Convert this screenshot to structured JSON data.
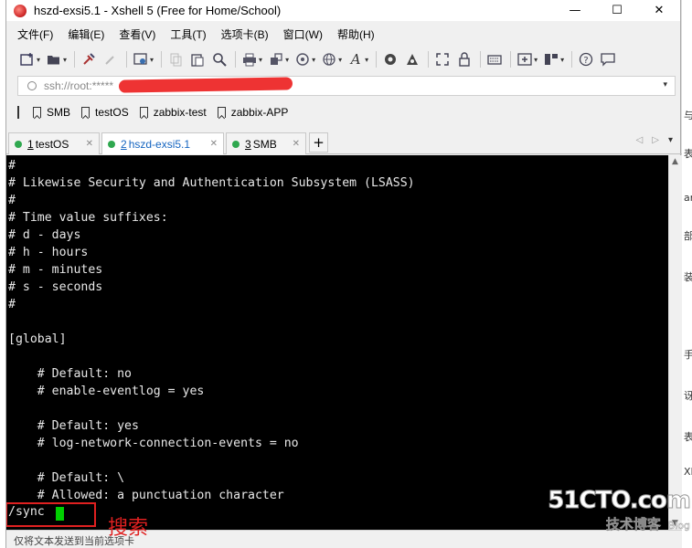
{
  "window": {
    "title": "hszd-exsi5.1 - Xshell 5 (Free for Home/School)",
    "controls": {
      "minimize": "—",
      "maximize": "☐",
      "close": "✕"
    }
  },
  "menu": [
    "文件(F)",
    "编辑(E)",
    "查看(V)",
    "工具(T)",
    "选项卡(B)",
    "窗口(W)",
    "帮助(H)"
  ],
  "address": {
    "value": "ssh://root:*****",
    "dropdown": "▾"
  },
  "bookmarks": [
    "SMB",
    "testOS",
    "zabbix-test",
    "zabbix-APP"
  ],
  "tabs": [
    {
      "num": "1",
      "label": "testOS",
      "close": "✕",
      "active": false
    },
    {
      "num": "2",
      "label": "hszd-exsi5.1",
      "close": "✕",
      "active": true
    },
    {
      "num": "3",
      "label": "SMB",
      "close": "✕",
      "active": false
    }
  ],
  "tab_add": "+",
  "tab_nav": {
    "prev": "◁",
    "next": "▷",
    "menu": "▾"
  },
  "terminal": {
    "lines": [
      "#",
      "# Likewise Security and Authentication Subsystem (LSASS)",
      "#",
      "# Time value suffixes:",
      "# d - days",
      "# h - hours",
      "# m - minutes",
      "# s - seconds",
      "#",
      "",
      "[global]",
      "",
      "    # Default: no",
      "    # enable-eventlog = yes",
      "",
      "    # Default: yes",
      "    # log-network-connection-events = no",
      "",
      "    # Default: \\",
      "    # Allowed: a punctuation character"
    ],
    "prompt": "/sync",
    "cursor_color": "#00d000"
  },
  "annotation": "搜索",
  "statusbar": {
    "text": "仅将文本发送到当前选项卡"
  },
  "watermark": {
    "main": "51CTO.com",
    "sub": "技术博客",
    "blog": "Blog"
  },
  "colors": {
    "accent": "#1565c0",
    "annotation": "#e02020",
    "tab_dot": "#2fa84f",
    "terminal_bg": "#000000"
  }
}
